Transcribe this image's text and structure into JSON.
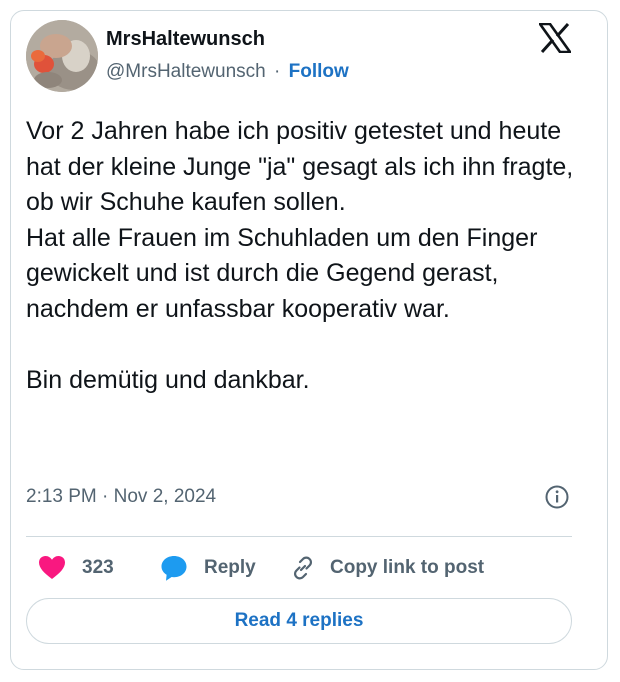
{
  "colors": {
    "text_primary": "#0f1419",
    "text_secondary": "#536471",
    "accent_link": "#1d72c4",
    "like_heart": "#f91880",
    "reply_bubble": "#1d9bf0",
    "border": "#cfd9de"
  },
  "author": {
    "display_name": "MrsHaltewunsch",
    "handle": "@MrsHaltewunsch",
    "separator": "·",
    "follow_label": "Follow",
    "avatar_icon": "profile-photo"
  },
  "brand": {
    "logo_icon": "x-logo-icon"
  },
  "tweet": {
    "paragraph_1": "Vor 2 Jahren habe ich positiv getestet und heute hat der kleine Junge \"ja\" gesagt als ich ihn fragte, ob wir Schuhe kaufen sollen.",
    "paragraph_2": "Hat alle Frauen im Schuhladen um den Finger gewickelt und ist durch die Gegend gerast, nachdem er unfassbar kooperativ war.",
    "paragraph_3": "Bin demütig und dankbar.",
    "timestamp": "2:13 PM · Nov 2, 2024"
  },
  "actions": {
    "like_count": "323",
    "reply_label": "Reply",
    "copy_link_label": "Copy link to post",
    "icons": [
      "heart-icon",
      "reply-bubble-icon",
      "link-icon",
      "info-icon"
    ]
  },
  "footer": {
    "read_replies_label": "Read 4 replies"
  }
}
